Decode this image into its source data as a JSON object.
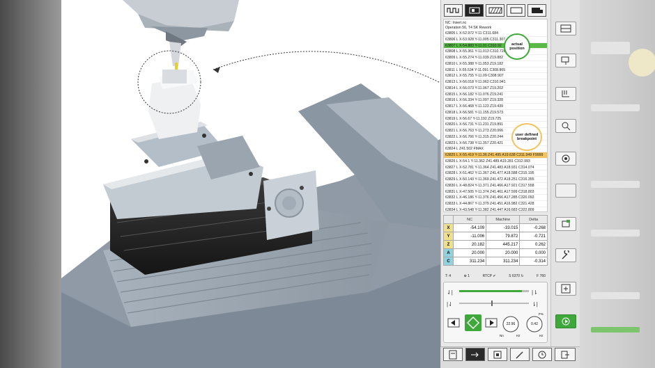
{
  "nc_header": {
    "line1": "NC: Insert.nc",
    "line2": "Operation 56, T4 SK  Rework"
  },
  "nc_lines": [
    "63805 L X-52.972 Y-11 C311.684",
    "63806 L X-53.928 Y-11.005 C311.307",
    "63807 L X-54.883 Y-11.01 C310.92",
    "63808 L X-55.361 Y-11.013 C310.726",
    "63809 L X-55.274 Y-11.039 Z19.882",
    "63810 L X-55.388 Y-11.053 Z19.182",
    "63811 L X-55.534 Y-11.091 C308.865",
    "63812 L X-55.755 Y-11.09 C308.907",
    "63813 L X-56.018 Y-11.062 C310.941",
    "63814 L X-56.073 Y-11.067 Z19.202",
    "63815 L X-56.182 Y-11.076 Z19.241",
    "63816 L X-56.334 Y-11.097 Z19.328",
    "63817 L X-56.468 Y-11.123 Z19.439",
    "63818 L X-56.581 Y-11.155 Z19.573",
    "63819 L X-56.67 Y-11.192 Z19.725",
    "63820 L X-56.731 Y-11.231 Z19.891",
    "63821 L X-56.763 Y-11.273 Z20.066",
    "63822 L X-56.766 Y-11.315 Z20.244",
    "63823 L X-56.738 Y-11.357 Z20.421",
    "63824 L Z41.502 FMAX",
    "63825 L X-55.419 Y-11.36 Z41.495 A19.638 C311.949 F9999",
    "63826 L X-54.1 Y-11.362 Z41.489 A19.281 C312.993",
    "63827 L X-52.781 Y-11.364 Z41.483 A18.931 C314.074",
    "63828 L X-51.462 Y-11.367 Z41.477 A18.588 C315.195",
    "63829 L X-50.143 Y-11.369 Z41.472 A18.251 C316.355",
    "63830 L X-48.824 Y-11.371 Z41.466 A17.921 C317.558",
    "63831 L X-47.505 Y-11.374 Z41.461 A17.599 C318.803",
    "63832 L X-46.186 Y-11.376 Z41.456 A17.285 C320.092",
    "63833 L X-44.867 Y-11.379 Z41.451 A16.982 C321.428",
    "63834 L X-43.548 Y-11.382 Z41.447 A16.683 C322.809"
  ],
  "current_line_index": 2,
  "breakpoint_line_index": 20,
  "callouts": {
    "actual_position": "actual position",
    "user_breakpoint": "user defined breakpoint"
  },
  "axes_table": {
    "headers": [
      "NC",
      "Machine",
      "Delta"
    ],
    "rows": [
      {
        "axis": "X",
        "color": "#f1e08a",
        "nc": "-54.109",
        "machine": "-33.015",
        "delta": "-0.268"
      },
      {
        "axis": "Y",
        "color": "#f1e08a",
        "nc": "-11.006",
        "machine": "79.872",
        "delta": "-0.721"
      },
      {
        "axis": "Z",
        "color": "#f1e08a",
        "nc": "20.182",
        "machine": "445.217",
        "delta": "0.262"
      },
      {
        "axis": "A",
        "color": "#8fd3e0",
        "nc": "20.000",
        "machine": "20.000",
        "delta": "0.000"
      },
      {
        "axis": "C",
        "color": "#8fd3e0",
        "nc": "311.234",
        "machine": "311.234",
        "delta": "-0.314"
      }
    ]
  },
  "status": {
    "tool": "T: 4",
    "comp": "1",
    "rtcp": "RTCP",
    "spindle": "S 6370",
    "feed": "F 760"
  },
  "controls": {
    "speed_dial": "22.96",
    "feed_dial": "0.42",
    "speed_unit": "Hz",
    "feed_unit": "Hz",
    "min_label": "Nn",
    "feed_pct": "F%"
  },
  "colors": {
    "accent_green": "#3ea93a",
    "breakpoint_orange": "#f2c35e",
    "machine_gray": "#9aa6b3"
  }
}
